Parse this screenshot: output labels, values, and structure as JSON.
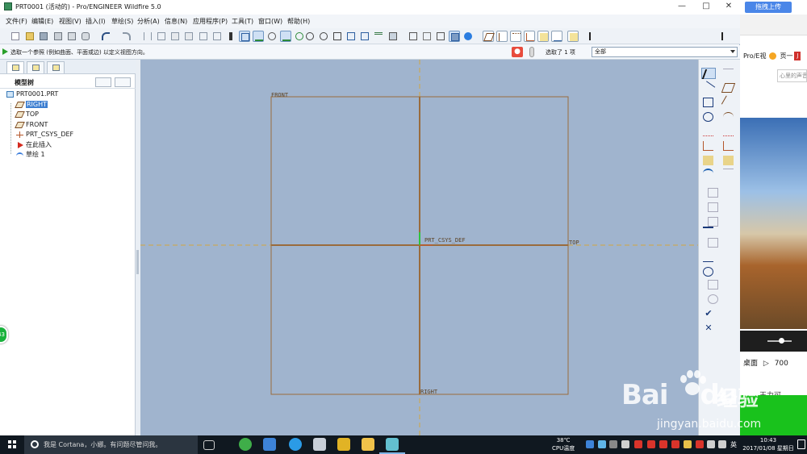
{
  "window": {
    "title": "PRT0001 (活动的) - Pro/ENGINEER Wildfire 5.0",
    "controls": {
      "minimize": "—",
      "maximize": "□",
      "close": "✕"
    }
  },
  "menu": [
    "文件(F)",
    "编辑(E)",
    "视图(V)",
    "插入(I)",
    "草绘(S)",
    "分析(A)",
    "信息(N)",
    "应用程序(P)",
    "工具(T)",
    "窗口(W)",
    "帮助(H)"
  ],
  "status": {
    "message": "选取一个参照 (例如曲面、平面或边) 以定义视图方向。",
    "selected": "选取了 1 项",
    "filter": "全部"
  },
  "model_tree": {
    "title": "模型树",
    "items": [
      {
        "label": "PRT0001.PRT",
        "icon": "part-icon"
      },
      {
        "label": "RIGHT",
        "icon": "datum-plane-icon",
        "selected": true
      },
      {
        "label": "TOP",
        "icon": "datum-plane-icon"
      },
      {
        "label": "FRONT",
        "icon": "datum-plane-icon"
      },
      {
        "label": "PRT_CSYS_DEF",
        "icon": "csys-icon"
      },
      {
        "label": "在此插入",
        "icon": "insert-here-icon"
      },
      {
        "label": "草绘 1",
        "icon": "sketch-icon"
      }
    ]
  },
  "graphics": {
    "labels": {
      "front": "FRONT",
      "csys": "PRT_CSYS_DEF",
      "top": "TOP",
      "right": "RIGHT"
    },
    "colors": {
      "background": "#a0b4ce",
      "datum": "#9a6b3c",
      "dashed": "#d2a640"
    }
  },
  "badge": {
    "value": "43"
  },
  "background_app": {
    "upload_button": "拖拽上传",
    "tab_text": "Pro/E视",
    "tab_text2": "页一",
    "tab_icon": "J",
    "search_placeholder": "心里的声音",
    "desktop": "桌面",
    "play_count": "700",
    "singer": "王力可"
  },
  "taskbar": {
    "cortana": "我是 Cortana，小娜。有问题尽管问我。",
    "temperature": "38℃",
    "temperature_label": "CPU温度",
    "ime": "英",
    "time": "10:43",
    "date": "2017/01/08 星期日"
  },
  "watermark": {
    "brand": "Bai",
    "brand_suffix": "du",
    "brand_cn": "经验",
    "url": "jingyan.baidu.com"
  }
}
